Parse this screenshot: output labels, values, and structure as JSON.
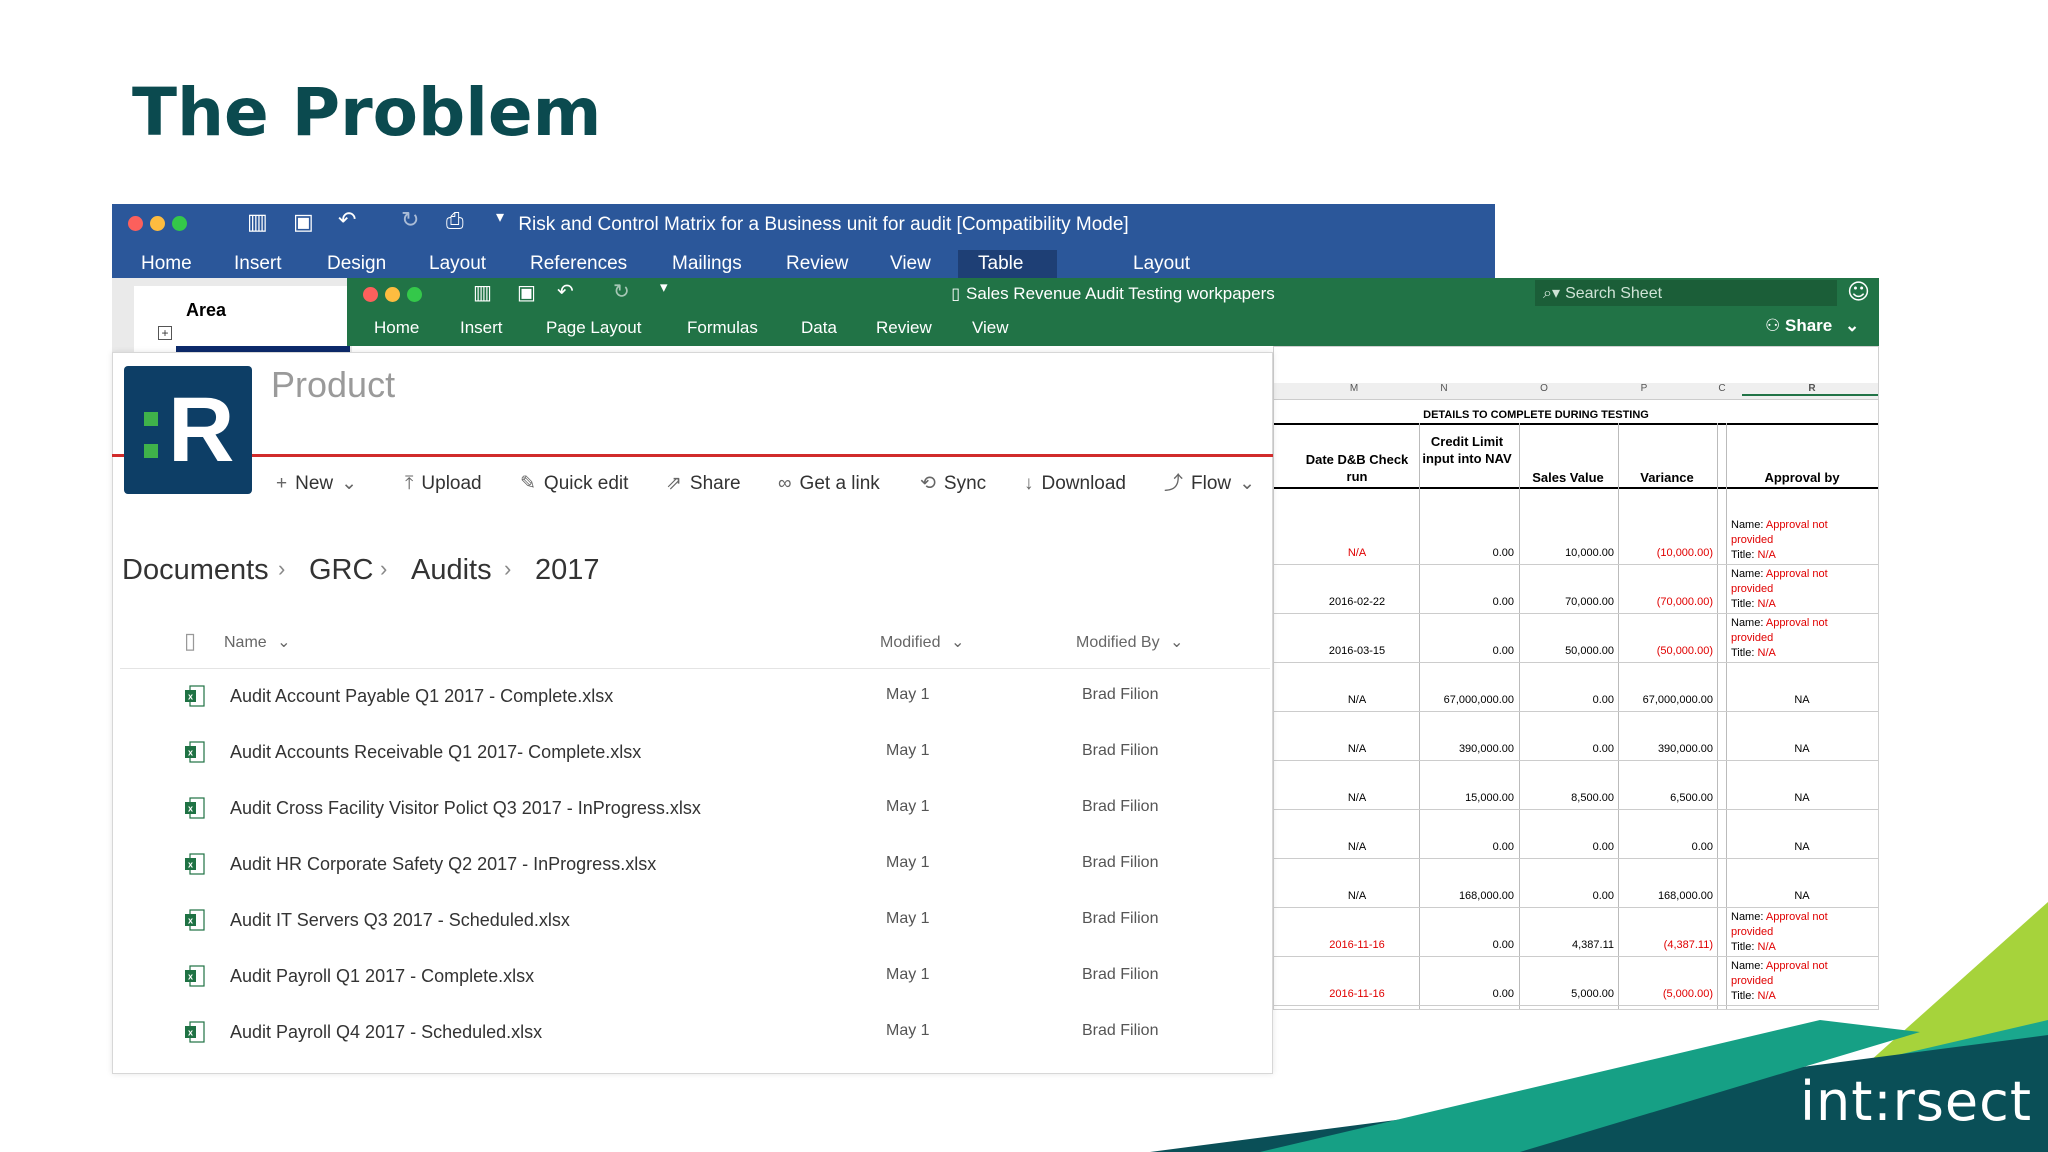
{
  "slide": {
    "title": "The Problem",
    "brand": "int:rsect"
  },
  "word": {
    "title": "Risk and Control Matrix for a Business unit for audit [Compatibility Mode]",
    "tabs": [
      "Home",
      "Insert",
      "Design",
      "Layout",
      "References",
      "Mailings",
      "Review",
      "View",
      "Table Design",
      "Layout"
    ],
    "selected_tab": "Table Design",
    "area_label": "Area"
  },
  "excel": {
    "title": "Sales Revenue Audit Testing workpapers",
    "tabs": [
      "Home",
      "Insert",
      "Page Layout",
      "Formulas",
      "Data",
      "Review",
      "View"
    ],
    "search_placeholder": "Search Sheet",
    "share_label": "Share",
    "columns": [
      "M",
      "N",
      "O",
      "P",
      "C",
      "R"
    ],
    "section_header": "DETAILS TO COMPLETE DURING TESTING",
    "headers": [
      "Date D&B Check run",
      "Credit Limit input into NAV",
      "Sales Value",
      "Variance",
      "Approval by"
    ],
    "rows": [
      {
        "date": "N/A",
        "date_red": true,
        "credit": "0.00",
        "sales": "10,000.00",
        "variance": "(10,000.00)",
        "var_red": true,
        "approval": "name"
      },
      {
        "date": "2016-02-22",
        "date_red": false,
        "credit": "0.00",
        "sales": "70,000.00",
        "variance": "(70,000.00)",
        "var_red": true,
        "approval": "name"
      },
      {
        "date": "2016-03-15",
        "date_red": false,
        "credit": "0.00",
        "sales": "50,000.00",
        "variance": "(50,000.00)",
        "var_red": true,
        "approval": "name"
      },
      {
        "date": "N/A",
        "date_red": false,
        "credit": "67,000,000.00",
        "sales": "0.00",
        "variance": "67,000,000.00",
        "var_red": false,
        "approval": "NA"
      },
      {
        "date": "N/A",
        "date_red": false,
        "credit": "390,000.00",
        "sales": "0.00",
        "variance": "390,000.00",
        "var_red": false,
        "approval": "NA"
      },
      {
        "date": "N/A",
        "date_red": false,
        "credit": "15,000.00",
        "sales": "8,500.00",
        "variance": "6,500.00",
        "var_red": false,
        "approval": "NA"
      },
      {
        "date": "N/A",
        "date_red": false,
        "credit": "0.00",
        "sales": "0.00",
        "variance": "0.00",
        "var_red": false,
        "approval": "NA"
      },
      {
        "date": "N/A",
        "date_red": false,
        "credit": "168,000.00",
        "sales": "0.00",
        "variance": "168,000.00",
        "var_red": false,
        "approval": "NA"
      },
      {
        "date": "2016-11-16",
        "date_red": true,
        "credit": "0.00",
        "sales": "4,387.11",
        "variance": "(4,387.11)",
        "var_red": true,
        "approval": "name"
      },
      {
        "date": "2016-11-16",
        "date_red": true,
        "credit": "0.00",
        "sales": "5,000.00",
        "variance": "(5,000.00)",
        "var_red": true,
        "approval": "name"
      }
    ],
    "approval_name_label": "Name:",
    "approval_not_provided": "Approval not provided",
    "approval_title_label": "Title:",
    "approval_title_value": "N/A"
  },
  "sharepoint": {
    "site_name": "Product",
    "logo_letter": "R",
    "commands": [
      "New",
      "Upload",
      "Quick edit",
      "Share",
      "Get a link",
      "Sync",
      "Download",
      "Flow"
    ],
    "breadcrumb": [
      "Documents",
      "GRC",
      "Audits",
      "2017"
    ],
    "columns": {
      "name": "Name",
      "modified": "Modified",
      "modified_by": "Modified By"
    },
    "files": [
      {
        "name": "Audit Account Payable Q1 2017 - Complete.xlsx",
        "modified": "May 1",
        "by": "Brad Filion"
      },
      {
        "name": "Audit Accounts Receivable Q1 2017- Complete.xlsx",
        "modified": "May 1",
        "by": "Brad Filion"
      },
      {
        "name": "Audit Cross Facility Visitor Polict Q3 2017 - InProgress.xlsx",
        "modified": "May 1",
        "by": "Brad Filion"
      },
      {
        "name": "Audit HR Corporate Safety Q2 2017 - InProgress.xlsx",
        "modified": "May 1",
        "by": "Brad Filion"
      },
      {
        "name": "Audit IT Servers Q3 2017 - Scheduled.xlsx",
        "modified": "May 1",
        "by": "Brad Filion"
      },
      {
        "name": "Audit Payroll Q1 2017 - Complete.xlsx",
        "modified": "May 1",
        "by": "Brad Filion"
      },
      {
        "name": "Audit Payroll Q4 2017 - Scheduled.xlsx",
        "modified": "May 1",
        "by": "Brad Filion"
      }
    ]
  },
  "colors": {
    "title": "#0b4a4f",
    "word_blue": "#2b579a",
    "excel_green": "#217346",
    "logo_navy": "#0d3e66",
    "accent_red": "#d12b2b",
    "teal": "#0a4f57",
    "lime": "#9ccf3a"
  }
}
